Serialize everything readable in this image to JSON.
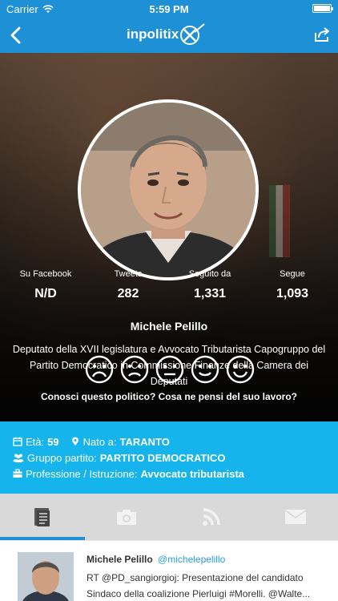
{
  "status_bar": {
    "carrier": "Carrier",
    "time": "5:59 PM"
  },
  "navbar": {
    "logo": "inpolitix"
  },
  "stats": [
    {
      "label": "Su Facebook",
      "value": "N/D"
    },
    {
      "label": "Tweets",
      "value": "282"
    },
    {
      "label": "Seguito da",
      "value": "1,331"
    },
    {
      "label": "Segue",
      "value": "1,093"
    }
  ],
  "profile": {
    "name": "Michele Pelillo",
    "bio": "Deputato della XVII legislatura e Avvocato Tributarista Capogruppo del Partito Democratico in Commissione Finanze della Camera dei Deputati"
  },
  "rating": {
    "question": "Conosci questo politico? Cosa ne pensi del suo lavoro?",
    "faces": [
      "very-sad-face-icon",
      "sad-face-icon",
      "neutral-face-icon",
      "smile-face-icon",
      "very-happy-face-icon"
    ]
  },
  "info": {
    "age_label": "Età:",
    "age_value": "59",
    "birthplace_label": "Nato a:",
    "birthplace_value": "TARANTO",
    "party_label": "Gruppo partito:",
    "party_value": "PARTITO DEMOCRATICO",
    "profession_label": "Professione / Istruzione:",
    "profession_value": "Avvocato tributarista"
  },
  "tabs": [
    "news-icon",
    "camera-icon",
    "rss-icon",
    "mail-icon"
  ],
  "tweet": {
    "name": "Michele Pelillo",
    "handle": "@michelepelillo",
    "line1": "RT @PD_sangiorgioj: Presentazione del candidato",
    "line2": "Sindaco della coalizione Pierluigi #Morelli. @Walte..."
  },
  "colors": {
    "brand_blue": "#1e90d6",
    "info_blue": "#15b4ec",
    "tab_gray": "#d9d9d9",
    "handle_blue": "#2a9fe0"
  }
}
